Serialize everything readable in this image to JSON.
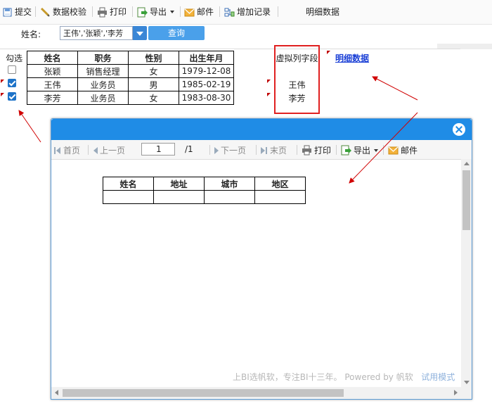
{
  "toolbar": {
    "submit": "提交",
    "validate": "数据校验",
    "print": "打印",
    "export": "导出",
    "mail": "邮件",
    "add_record": "增加记录",
    "title": "明细数据"
  },
  "query": {
    "label": "姓名:",
    "value": "王伟','张颖','李芳",
    "button": "查询"
  },
  "main_table": {
    "check_header": "勾选",
    "headers": [
      "姓名",
      "职务",
      "性别",
      "出生年月"
    ],
    "rows": [
      {
        "checked": false,
        "cells": [
          "张颖",
          "销售经理",
          "女",
          "1979-12-08"
        ]
      },
      {
        "checked": true,
        "cells": [
          "王伟",
          "业务员",
          "男",
          "1985-02-19"
        ]
      },
      {
        "checked": true,
        "cells": [
          "李芳",
          "业务员",
          "女",
          "1983-08-30"
        ]
      }
    ]
  },
  "virtual_column": {
    "header": "虚拟列字段",
    "values": [
      "王伟",
      "李芳"
    ]
  },
  "detail_link": "明细数据",
  "dialog": {
    "toolbar": {
      "first": "首页",
      "prev": "上一页",
      "page": "1",
      "total": "/1",
      "next": "下一页",
      "last": "末页",
      "print": "打印",
      "export": "导出",
      "mail": "邮件"
    },
    "table_headers": [
      "姓名",
      "地址",
      "城市",
      "地区"
    ],
    "watermark": "上BI选帆软，专注BI十三年。 Powered by 帆软",
    "trial_mode": "试用模式"
  },
  "colors": {
    "accent": "#1f8ce6",
    "query_button": "#4aa0ea",
    "annotation": "#e02020",
    "link": "#1a3fd6"
  },
  "icons": [
    "submit-icon",
    "validate-icon",
    "print-icon",
    "export-icon",
    "mail-icon",
    "add-record-icon",
    "close-icon"
  ]
}
